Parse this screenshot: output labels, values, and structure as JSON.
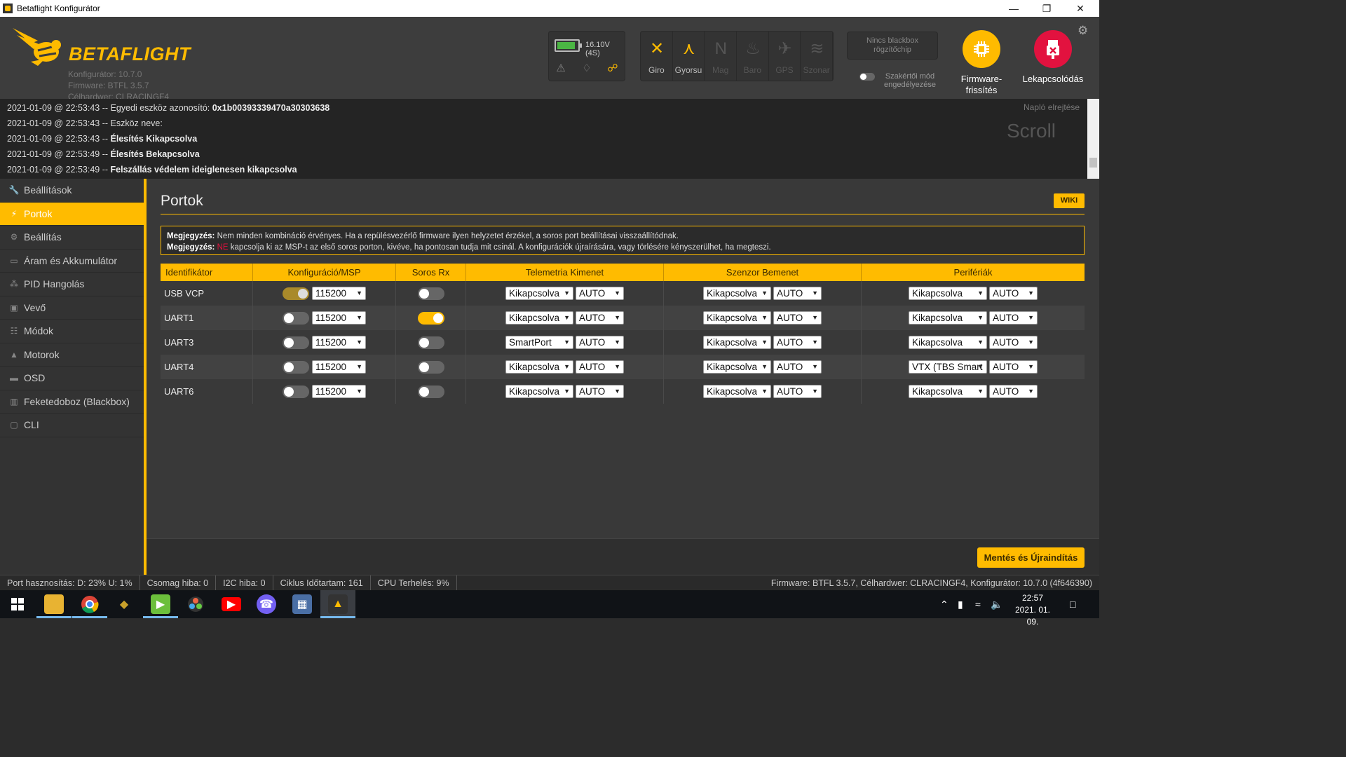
{
  "window": {
    "title": "Betaflight Konfigurátor"
  },
  "header": {
    "brand": "BETAFLIGHT",
    "configurator": "Konfigurátor: 10.7.0",
    "firmware": "Firmware: BTFL 3.5.7",
    "target": "Célhardwer: CLRACINGF4",
    "battery_text": "16.10V (4S)",
    "battery_level": 0.9,
    "sensors": [
      {
        "label": "Giro",
        "icon": "gyro-icon",
        "active": true
      },
      {
        "label": "Gyorsu",
        "icon": "accelerometer-icon",
        "active": true
      },
      {
        "label": "Mag",
        "icon": "magnetometer-icon",
        "active": false
      },
      {
        "label": "Baro",
        "icon": "barometer-icon",
        "active": false
      },
      {
        "label": "GPS",
        "icon": "gps-icon",
        "active": false
      },
      {
        "label": "Szonar",
        "icon": "sonar-icon",
        "active": false
      }
    ],
    "blackbox_line1": "Nincs blackbox",
    "blackbox_line2": "rögzítőchip",
    "expert_mode_line1": "Szakértői mód",
    "expert_mode_line2": "engedélyezése",
    "firmware_flasher_line1": "Firmware-",
    "firmware_flasher_line2": "frissítés",
    "disconnect_label": "Lekapcsolódás"
  },
  "log": {
    "lines": [
      {
        "prefix": "2021-01-09 @ 22:53:43 -- Egyedi eszköz azonosító: ",
        "bold": "0x1b00393339470a30303638"
      },
      {
        "prefix": "2021-01-09 @ 22:53:43 -- Eszköz neve:",
        "bold": ""
      },
      {
        "prefix": "2021-01-09 @ 22:53:43 -- ",
        "bold": "Élesítés Kikapcsolva"
      },
      {
        "prefix": "2021-01-09 @ 22:53:49 -- ",
        "bold": "Élesítés Bekapcsolva"
      },
      {
        "prefix": "2021-01-09 @ 22:53:49 -- ",
        "bold": "Felszállás védelem ideiglenesen kikapcsolva"
      }
    ],
    "hide_label": "Napló elrejtése",
    "scroll_label": "Scroll"
  },
  "sidebar": {
    "items": [
      {
        "label": "Beállítások",
        "icon": "wrench-icon"
      },
      {
        "label": "Portok",
        "icon": "plug-icon"
      },
      {
        "label": "Beállítás",
        "icon": "gear-icon"
      },
      {
        "label": "Áram és Akkumulátor",
        "icon": "battery-icon"
      },
      {
        "label": "PID Hangolás",
        "icon": "pid-icon"
      },
      {
        "label": "Vevő",
        "icon": "receiver-icon"
      },
      {
        "label": "Módok",
        "icon": "modes-icon"
      },
      {
        "label": "Motorok",
        "icon": "motor-icon"
      },
      {
        "label": "OSD",
        "icon": "osd-icon"
      },
      {
        "label": "Feketedoboz (Blackbox)",
        "icon": "blackbox-icon"
      },
      {
        "label": "CLI",
        "icon": "cli-icon"
      }
    ],
    "active_index": 1
  },
  "main": {
    "title": "Portok",
    "wiki_label": "WIKI",
    "note1_bold": "Megjegyzés:",
    "note1_text": " Nem minden kombináció érvényes. Ha a repülésvezérlő firmware ilyen helyzetet érzékel, a soros port beállításai visszaállítódnak.",
    "note2_bold": "Megjegyzés:",
    "note2_red": "NE",
    "note2_text": " kapcsolja ki az MSP-t az első soros porton, kivéve, ha pontosan tudja mit csinál. A konfigurációk újraírására, vagy törlésére kényszerülhet, ha megteszi.",
    "save_label": "Mentés és Újraindítás"
  },
  "ports": {
    "headers": [
      "Identifikátor",
      "Konfiguráció/MSP",
      "Soros Rx",
      "Telemetria Kimenet",
      "Szenzor Bemenet",
      "Perifériák"
    ],
    "rows": [
      {
        "id": "USB VCP",
        "msp": true,
        "msp_locked": true,
        "baud": "115200",
        "rx": false,
        "telemetry": "Kikapcsolva",
        "telemetry_baud": "AUTO",
        "sensor": "Kikapcsolva",
        "sensor_baud": "AUTO",
        "peripheral": "Kikapcsolva",
        "peripheral_baud": "AUTO"
      },
      {
        "id": "UART1",
        "msp": false,
        "msp_locked": false,
        "baud": "115200",
        "rx": true,
        "telemetry": "Kikapcsolva",
        "telemetry_baud": "AUTO",
        "sensor": "Kikapcsolva",
        "sensor_baud": "AUTO",
        "peripheral": "Kikapcsolva",
        "peripheral_baud": "AUTO"
      },
      {
        "id": "UART3",
        "msp": false,
        "msp_locked": false,
        "baud": "115200",
        "rx": false,
        "telemetry": "SmartPort",
        "telemetry_baud": "AUTO",
        "sensor": "Kikapcsolva",
        "sensor_baud": "AUTO",
        "peripheral": "Kikapcsolva",
        "peripheral_baud": "AUTO"
      },
      {
        "id": "UART4",
        "msp": false,
        "msp_locked": false,
        "baud": "115200",
        "rx": false,
        "telemetry": "Kikapcsolva",
        "telemetry_baud": "AUTO",
        "sensor": "Kikapcsolva",
        "sensor_baud": "AUTO",
        "peripheral": "VTX (TBS Smart",
        "peripheral_baud": "AUTO"
      },
      {
        "id": "UART6",
        "msp": false,
        "msp_locked": false,
        "baud": "115200",
        "rx": false,
        "telemetry": "Kikapcsolva",
        "telemetry_baud": "AUTO",
        "sensor": "Kikapcsolva",
        "sensor_baud": "AUTO",
        "peripheral": "Kikapcsolva",
        "peripheral_baud": "AUTO"
      }
    ]
  },
  "status": {
    "port_usage": "Port hasznosítás: D: 23% U: 1%",
    "packet_error": "Csomag hiba: 0",
    "i2c_error": "I2C hiba: 0",
    "cycle_time": "Ciklus Időtartam: 161",
    "cpu_load": "CPU Terhelés: 9%",
    "version_info": "Firmware: BTFL 3.5.7, Célhardwer: CLRACINGF4, Konfigurátor: 10.7.0 (4f646390)"
  },
  "taskbar": {
    "time": "22:57",
    "date": "2021. 01. 09."
  },
  "colors": {
    "accent": "#ffbb00",
    "danger": "#e2123f"
  }
}
